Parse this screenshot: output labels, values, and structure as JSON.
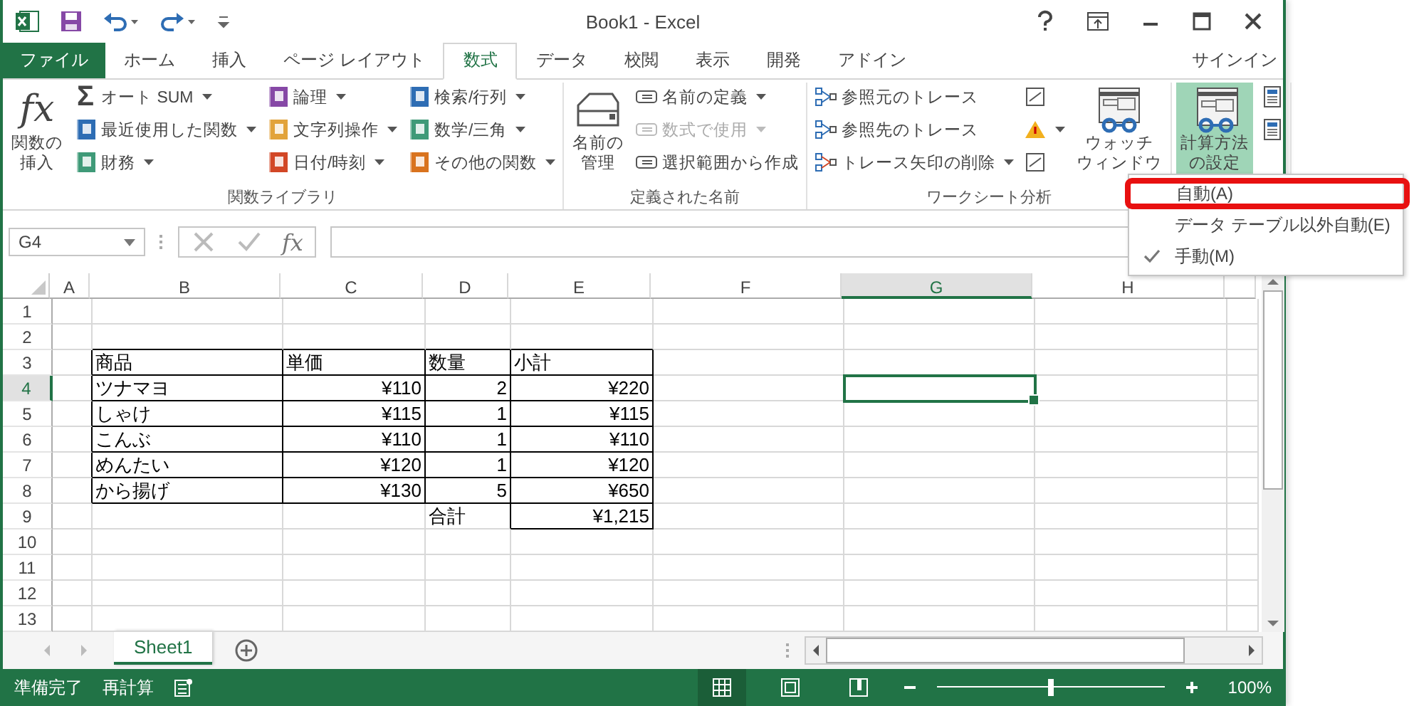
{
  "window": {
    "title": "Book1 - Excel"
  },
  "tabs": [
    {
      "label": "ファイル",
      "kind": "file"
    },
    {
      "label": "ホーム",
      "kind": "tab",
      "selected": false
    },
    {
      "label": "挿入",
      "kind": "tab",
      "selected": false
    },
    {
      "label": "ページ レイアウト",
      "kind": "tab",
      "selected": false
    },
    {
      "label": "数式",
      "kind": "tab",
      "selected": true
    },
    {
      "label": "データ",
      "kind": "tab",
      "selected": false
    },
    {
      "label": "校閲",
      "kind": "tab",
      "selected": false
    },
    {
      "label": "表示",
      "kind": "tab",
      "selected": false
    },
    {
      "label": "開発",
      "kind": "tab",
      "selected": false
    },
    {
      "label": "アドイン",
      "kind": "tab",
      "selected": false
    }
  ],
  "sign_in": "サインイン",
  "ribbon": {
    "groups": [
      {
        "label": "関数ライブラリ",
        "large": [
          {
            "lines": [
              "関数の",
              "挿入"
            ],
            "symbol": "fx",
            "dropdown": false,
            "pressed": false
          }
        ],
        "columns": [
          [
            {
              "label": "オート SUM",
              "symbol": "Σ",
              "dropdown": true,
              "disabled": false
            },
            {
              "label": "最近使用した関数",
              "dropdown": true,
              "disabled": false
            },
            {
              "label": "財務",
              "dropdown": true,
              "disabled": false
            }
          ],
          [
            {
              "label": "論理",
              "dropdown": true,
              "disabled": false
            },
            {
              "label": "文字列操作",
              "dropdown": true,
              "disabled": false
            },
            {
              "label": "日付/時刻",
              "dropdown": true,
              "disabled": false
            }
          ],
          [
            {
              "label": "検索/行列",
              "dropdown": true,
              "disabled": false
            },
            {
              "label": "数学/三角",
              "dropdown": true,
              "disabled": false
            },
            {
              "label": "その他の関数",
              "dropdown": true,
              "disabled": false
            }
          ]
        ]
      },
      {
        "label": "定義された名前",
        "large": [
          {
            "lines": [
              "名前の",
              "管理"
            ],
            "dropdown": false,
            "pressed": false
          }
        ],
        "columns": [
          [
            {
              "label": "名前の定義",
              "dropdown": true,
              "disabled": false
            },
            {
              "label": "数式で使用",
              "dropdown": true,
              "disabled": true
            },
            {
              "label": "選択範囲から作成",
              "dropdown": false,
              "disabled": false
            }
          ]
        ]
      },
      {
        "label": "ワークシート分析",
        "columns": [
          [
            {
              "label": "参照元のトレース",
              "dropdown": false,
              "disabled": false
            },
            {
              "label": "参照先のトレース",
              "dropdown": false,
              "disabled": false
            },
            {
              "label": "トレース矢印の削除",
              "dropdown": true,
              "disabled": false
            }
          ],
          [
            {
              "dropdown": false
            },
            {
              "dropdown": true
            },
            {
              "dropdown": false
            }
          ]
        ],
        "large_after": [
          {
            "lines": [
              "ウォッチ",
              "ウィンドウ"
            ],
            "pressed": false
          }
        ]
      },
      {
        "large": [
          {
            "lines": [
              "計算方法",
              "の設定"
            ],
            "dropdown": true,
            "pressed": true
          }
        ],
        "columns": [
          [
            {
              "dropdown": false
            },
            {
              "dropdown": false
            }
          ]
        ]
      }
    ]
  },
  "formula_bar": {
    "name_box": "G4",
    "function_symbol": "fx"
  },
  "sheet": {
    "columns": [
      {
        "label": "A",
        "selected": false
      },
      {
        "label": "B",
        "selected": false
      },
      {
        "label": "C",
        "selected": false
      },
      {
        "label": "D",
        "selected": false
      },
      {
        "label": "E",
        "selected": false
      },
      {
        "label": "F",
        "selected": false
      },
      {
        "label": "G",
        "selected": true
      },
      {
        "label": "H",
        "selected": false
      }
    ],
    "rows": [
      {
        "label": "1",
        "selected": false
      },
      {
        "label": "2",
        "selected": false
      },
      {
        "label": "3",
        "selected": false
      },
      {
        "label": "4",
        "selected": true
      },
      {
        "label": "5",
        "selected": false
      },
      {
        "label": "6",
        "selected": false
      },
      {
        "label": "7",
        "selected": false
      },
      {
        "label": "8",
        "selected": false
      },
      {
        "label": "9",
        "selected": false
      },
      {
        "label": "10",
        "selected": false
      },
      {
        "label": "11",
        "selected": false
      },
      {
        "label": "12",
        "selected": false
      },
      {
        "label": "13",
        "selected": false
      }
    ],
    "table": {
      "header": [
        "商品",
        "単価",
        "数量",
        "小計"
      ],
      "rows": [
        [
          "ツナマヨ",
          "¥110",
          "2",
          "¥220"
        ],
        [
          "しゃけ",
          "¥115",
          "1",
          "¥115"
        ],
        [
          "こんぶ",
          "¥110",
          "1",
          "¥110"
        ],
        [
          "めんたい",
          "¥120",
          "1",
          "¥120"
        ],
        [
          "から揚げ",
          "¥130",
          "5",
          "¥650"
        ]
      ],
      "total_label": "合計",
      "total": "¥1,215"
    }
  },
  "sheet_tabs": [
    {
      "label": "Sheet1",
      "selected": true
    }
  ],
  "status_bar": {
    "ready": "準備完了",
    "recalc": "再計算",
    "views": [
      {
        "selected": true
      },
      {
        "selected": false
      },
      {
        "selected": false
      }
    ],
    "zoom": {
      "level": 0.5,
      "reading": "100%"
    }
  },
  "menu": {
    "items": [
      {
        "label": "自動(A)",
        "checked": false,
        "highlighted": true
      },
      {
        "label": "データ テーブル以外自動(E)",
        "checked": false,
        "highlighted": false
      },
      {
        "label": "手動(M)",
        "checked": true,
        "highlighted": false
      }
    ]
  }
}
